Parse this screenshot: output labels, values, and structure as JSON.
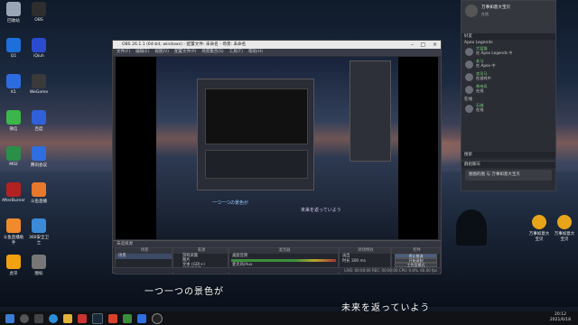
{
  "desktop": {
    "icons": [
      {
        "label": "回收站",
        "color": "#9aa5b5"
      },
      {
        "label": "OBS",
        "color": "#2e2e2e"
      },
      {
        "label": "Q1",
        "color": "#1e6fd9"
      },
      {
        "label": "iQiuh",
        "color": "#2a4bd0"
      },
      {
        "label": "K1",
        "color": "#2d6cdf"
      },
      {
        "label": "WeGame",
        "color": "#3a3a3a"
      },
      {
        "label": "微信",
        "color": "#3cb64a"
      },
      {
        "label": "百度",
        "color": "#2f60d8"
      },
      {
        "label": "M02",
        "color": "#2a8f48"
      },
      {
        "label": "腾讯会议",
        "color": "#2f6ee0"
      },
      {
        "label": "AfterBurner",
        "color": "#b32222"
      },
      {
        "label": "斗鱼直播",
        "color": "#e8782b"
      },
      {
        "label": "斗鱼直播助手",
        "color": "#f08a2c"
      },
      {
        "label": "360安全卫士",
        "color": "#3c8bd9"
      },
      {
        "label": "虎牙",
        "color": "#f2a20f"
      },
      {
        "label": "图标",
        "color": "#777777"
      }
    ],
    "right_icons": [
      {
        "label": "万事如意大宝贝",
        "color": "#e6a41b"
      },
      {
        "label": "万事如意大宝贝",
        "color": "#e6a41b"
      }
    ]
  },
  "obs": {
    "title": "OBS 26.1.1 (64-bit, windows) - 配置文件: 未命名 - 场景: 未命名",
    "menu": [
      "文件(F)",
      "编辑(E)",
      "视图(V)",
      "配置文件(P)",
      "场景集合(S)",
      "工具(T)",
      "帮助(H)"
    ],
    "no_source_label": "未选择源",
    "docks": {
      "scenes": {
        "title": "场景",
        "items": [
          "场景"
        ]
      },
      "sources": {
        "title": "来源",
        "items": [
          "游戏采集",
          "图片",
          "文本 (GDI+)",
          "显示器采集"
        ]
      },
      "mixer": {
        "title": "混音器",
        "channels": [
          {
            "label": "桌面音频",
            "db": "0.0 dB"
          },
          {
            "label": "麦克风/Aux",
            "db": "0.0 dB"
          }
        ]
      },
      "transitions": {
        "title": "转场特效",
        "fade": "淡出",
        "duration_label": "时长",
        "duration": "300 ms"
      },
      "controls": {
        "title": "控件",
        "buttons": [
          "停止推流",
          "开始录制",
          "工作室模式",
          "设置",
          "退出"
        ]
      }
    },
    "status": "LIVE: 00:00:00   REC: 00:00:00   CPU: 0.8%, 60.00 fps"
  },
  "preview": {
    "subtitle_left": "一つ一つの景色が",
    "subtitle_right": "未来を返っていよう"
  },
  "chat_panel": {
    "user": "万事如意大宝贝",
    "status": "在线",
    "group_label": "好友",
    "section_game": "Apex Legends",
    "messages": [
      {
        "name": "大猛猫",
        "text": "在 Apex Legends 中"
      },
      {
        "name": "老马",
        "text": "在 Apex 中"
      },
      {
        "name": "卖司马",
        "text": "在游戏中"
      },
      {
        "name": "希帝风",
        "text": "在线"
      }
    ],
    "section_other": "在线",
    "other": [
      {
        "name": "石佛",
        "text": "在线"
      }
    ],
    "input_bar": "搜索",
    "bottom_item": "图图的图 与 万事如意大宝贝",
    "group_chat_label": "群组聊天"
  },
  "subtitles": {
    "left": "一つ一つの景色が",
    "right": "未来を返っていよう"
  },
  "taskbar": {
    "time": "20:12",
    "date": "2021/6/18"
  }
}
